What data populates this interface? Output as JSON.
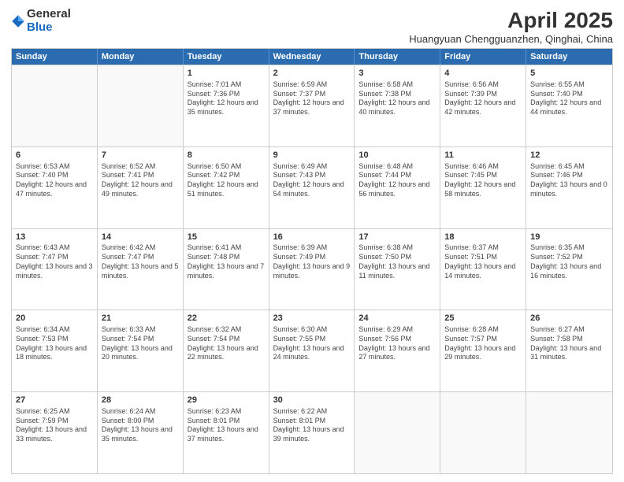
{
  "logo": {
    "general": "General",
    "blue": "Blue"
  },
  "title": "April 2025",
  "subtitle": "Huangyuan Chengguanzhen, Qinghai, China",
  "header_days": [
    "Sunday",
    "Monday",
    "Tuesday",
    "Wednesday",
    "Thursday",
    "Friday",
    "Saturday"
  ],
  "weeks": [
    [
      {
        "day": "",
        "info": ""
      },
      {
        "day": "",
        "info": ""
      },
      {
        "day": "1",
        "info": "Sunrise: 7:01 AM\nSunset: 7:36 PM\nDaylight: 12 hours and 35 minutes."
      },
      {
        "day": "2",
        "info": "Sunrise: 6:59 AM\nSunset: 7:37 PM\nDaylight: 12 hours and 37 minutes."
      },
      {
        "day": "3",
        "info": "Sunrise: 6:58 AM\nSunset: 7:38 PM\nDaylight: 12 hours and 40 minutes."
      },
      {
        "day": "4",
        "info": "Sunrise: 6:56 AM\nSunset: 7:39 PM\nDaylight: 12 hours and 42 minutes."
      },
      {
        "day": "5",
        "info": "Sunrise: 6:55 AM\nSunset: 7:40 PM\nDaylight: 12 hours and 44 minutes."
      }
    ],
    [
      {
        "day": "6",
        "info": "Sunrise: 6:53 AM\nSunset: 7:40 PM\nDaylight: 12 hours and 47 minutes."
      },
      {
        "day": "7",
        "info": "Sunrise: 6:52 AM\nSunset: 7:41 PM\nDaylight: 12 hours and 49 minutes."
      },
      {
        "day": "8",
        "info": "Sunrise: 6:50 AM\nSunset: 7:42 PM\nDaylight: 12 hours and 51 minutes."
      },
      {
        "day": "9",
        "info": "Sunrise: 6:49 AM\nSunset: 7:43 PM\nDaylight: 12 hours and 54 minutes."
      },
      {
        "day": "10",
        "info": "Sunrise: 6:48 AM\nSunset: 7:44 PM\nDaylight: 12 hours and 56 minutes."
      },
      {
        "day": "11",
        "info": "Sunrise: 6:46 AM\nSunset: 7:45 PM\nDaylight: 12 hours and 58 minutes."
      },
      {
        "day": "12",
        "info": "Sunrise: 6:45 AM\nSunset: 7:46 PM\nDaylight: 13 hours and 0 minutes."
      }
    ],
    [
      {
        "day": "13",
        "info": "Sunrise: 6:43 AM\nSunset: 7:47 PM\nDaylight: 13 hours and 3 minutes."
      },
      {
        "day": "14",
        "info": "Sunrise: 6:42 AM\nSunset: 7:47 PM\nDaylight: 13 hours and 5 minutes."
      },
      {
        "day": "15",
        "info": "Sunrise: 6:41 AM\nSunset: 7:48 PM\nDaylight: 13 hours and 7 minutes."
      },
      {
        "day": "16",
        "info": "Sunrise: 6:39 AM\nSunset: 7:49 PM\nDaylight: 13 hours and 9 minutes."
      },
      {
        "day": "17",
        "info": "Sunrise: 6:38 AM\nSunset: 7:50 PM\nDaylight: 13 hours and 11 minutes."
      },
      {
        "day": "18",
        "info": "Sunrise: 6:37 AM\nSunset: 7:51 PM\nDaylight: 13 hours and 14 minutes."
      },
      {
        "day": "19",
        "info": "Sunrise: 6:35 AM\nSunset: 7:52 PM\nDaylight: 13 hours and 16 minutes."
      }
    ],
    [
      {
        "day": "20",
        "info": "Sunrise: 6:34 AM\nSunset: 7:53 PM\nDaylight: 13 hours and 18 minutes."
      },
      {
        "day": "21",
        "info": "Sunrise: 6:33 AM\nSunset: 7:54 PM\nDaylight: 13 hours and 20 minutes."
      },
      {
        "day": "22",
        "info": "Sunrise: 6:32 AM\nSunset: 7:54 PM\nDaylight: 13 hours and 22 minutes."
      },
      {
        "day": "23",
        "info": "Sunrise: 6:30 AM\nSunset: 7:55 PM\nDaylight: 13 hours and 24 minutes."
      },
      {
        "day": "24",
        "info": "Sunrise: 6:29 AM\nSunset: 7:56 PM\nDaylight: 13 hours and 27 minutes."
      },
      {
        "day": "25",
        "info": "Sunrise: 6:28 AM\nSunset: 7:57 PM\nDaylight: 13 hours and 29 minutes."
      },
      {
        "day": "26",
        "info": "Sunrise: 6:27 AM\nSunset: 7:58 PM\nDaylight: 13 hours and 31 minutes."
      }
    ],
    [
      {
        "day": "27",
        "info": "Sunrise: 6:25 AM\nSunset: 7:59 PM\nDaylight: 13 hours and 33 minutes."
      },
      {
        "day": "28",
        "info": "Sunrise: 6:24 AM\nSunset: 8:00 PM\nDaylight: 13 hours and 35 minutes."
      },
      {
        "day": "29",
        "info": "Sunrise: 6:23 AM\nSunset: 8:01 PM\nDaylight: 13 hours and 37 minutes."
      },
      {
        "day": "30",
        "info": "Sunrise: 6:22 AM\nSunset: 8:01 PM\nDaylight: 13 hours and 39 minutes."
      },
      {
        "day": "",
        "info": ""
      },
      {
        "day": "",
        "info": ""
      },
      {
        "day": "",
        "info": ""
      }
    ]
  ]
}
